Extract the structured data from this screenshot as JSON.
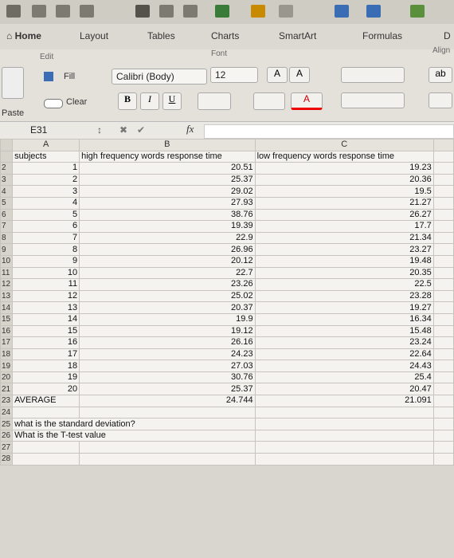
{
  "tabs": [
    "Home",
    "Layout",
    "Tables",
    "Charts",
    "SmartArt",
    "Formulas",
    "D"
  ],
  "ribbon": {
    "edit_label": "Edit",
    "fill_label": "Fill",
    "clear_label": "Clear",
    "paste_label": "Paste",
    "font_label": "Font",
    "font_name": "Calibri (Body)",
    "font_size": "12",
    "bold": "B",
    "italic": "I",
    "underline": "U",
    "align_label": "Align",
    "grow_font": "A",
    "shrink_font": "A",
    "font_color_a": "A",
    "wrap_text": "ab"
  },
  "formula_bar": {
    "name_box": "E31",
    "fx": "fx"
  },
  "columns": [
    "A",
    "B",
    "C"
  ],
  "headers": {
    "a": "subjects",
    "b": "high frequency words response time",
    "c": "low frequency words response time"
  },
  "rows": [
    {
      "n": "2",
      "subject": "1",
      "high": "20.51",
      "low": "19.23"
    },
    {
      "n": "3",
      "subject": "2",
      "high": "25.37",
      "low": "20.36"
    },
    {
      "n": "4",
      "subject": "3",
      "high": "29.02",
      "low": "19.5"
    },
    {
      "n": "5",
      "subject": "4",
      "high": "27.93",
      "low": "21.27"
    },
    {
      "n": "6",
      "subject": "5",
      "high": "38.76",
      "low": "26.27"
    },
    {
      "n": "7",
      "subject": "6",
      "high": "19.39",
      "low": "17.7"
    },
    {
      "n": "8",
      "subject": "7",
      "high": "22.9",
      "low": "21.34"
    },
    {
      "n": "9",
      "subject": "8",
      "high": "26.96",
      "low": "23.27"
    },
    {
      "n": "10",
      "subject": "9",
      "high": "20.12",
      "low": "19.48"
    },
    {
      "n": "11",
      "subject": "10",
      "high": "22.7",
      "low": "20.35"
    },
    {
      "n": "12",
      "subject": "11",
      "high": "23.26",
      "low": "22.5"
    },
    {
      "n": "13",
      "subject": "12",
      "high": "25.02",
      "low": "23.28"
    },
    {
      "n": "14",
      "subject": "13",
      "high": "20.37",
      "low": "19.27"
    },
    {
      "n": "15",
      "subject": "14",
      "high": "19.9",
      "low": "16.34"
    },
    {
      "n": "16",
      "subject": "15",
      "high": "19.12",
      "low": "15.48"
    },
    {
      "n": "17",
      "subject": "16",
      "high": "26.16",
      "low": "23.24"
    },
    {
      "n": "18",
      "subject": "17",
      "high": "24.23",
      "low": "22.64"
    },
    {
      "n": "19",
      "subject": "18",
      "high": "27.03",
      "low": "24.43"
    },
    {
      "n": "20",
      "subject": "19",
      "high": "30.76",
      "low": "25.4"
    },
    {
      "n": "21",
      "subject": "20",
      "high": "25.37",
      "low": "20.47"
    }
  ],
  "average": {
    "label": "AVERAGE",
    "high": "24.744",
    "low": "21.091"
  },
  "notes": [
    "what is the standard deviation?",
    "What is the T-test value"
  ],
  "extra_rows": [
    "23",
    "24",
    "25",
    "26",
    "27",
    "28"
  ]
}
